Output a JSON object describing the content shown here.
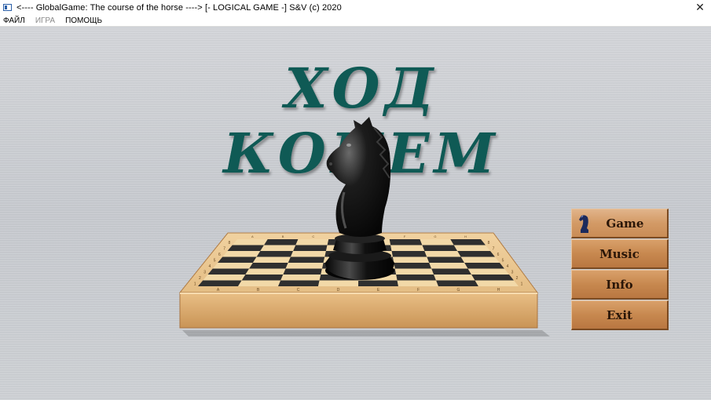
{
  "window": {
    "title": "<---- GlobalGame:  The course of the horse ----> [- LOGICAL GAME -]  S&V (c) 2020",
    "close_glyph": "✕"
  },
  "menubar": {
    "items": [
      {
        "label": "ФАЙЛ",
        "enabled": true
      },
      {
        "label": "ИГРА",
        "enabled": false
      },
      {
        "label": "ПОМОЩЬ",
        "enabled": true
      }
    ]
  },
  "main": {
    "title": "ХОД КОНЕМ",
    "board_files": [
      "A",
      "B",
      "C",
      "D",
      "E",
      "F",
      "G",
      "H"
    ],
    "board_ranks": [
      "1",
      "2",
      "3",
      "4",
      "5",
      "6",
      "7",
      "8"
    ],
    "buttons": [
      {
        "label": "Game",
        "icon": "knight-icon"
      },
      {
        "label": "Music"
      },
      {
        "label": "Info"
      },
      {
        "label": "Exit"
      }
    ]
  },
  "colors": {
    "title_text": "#0f5a55",
    "button_wood": "#c7884f",
    "board_light": "#f2d9a8",
    "board_dark": "#2f2f2f",
    "board_frame": "#e0b277"
  }
}
